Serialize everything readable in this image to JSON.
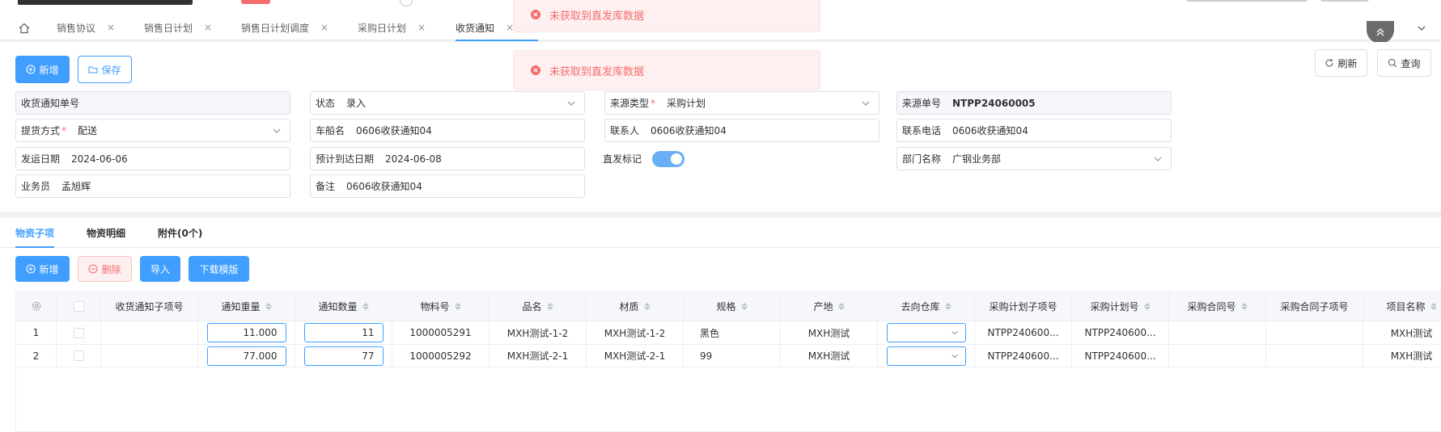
{
  "tabs": [
    {
      "label": "销售协议",
      "active": false
    },
    {
      "label": "销售日计划",
      "active": false
    },
    {
      "label": "销售日计划调度",
      "active": false
    },
    {
      "label": "采购日计划",
      "active": false
    },
    {
      "label": "收货通知",
      "active": true
    }
  ],
  "toasts": [
    {
      "text": "未获取到直发库数据"
    },
    {
      "text": "未获取到直发库数据"
    }
  ],
  "toolbar": {
    "add_label": "新增",
    "save_label": "保存",
    "refresh_label": "刷新",
    "query_label": "查询"
  },
  "form": {
    "receipt_no": {
      "label": "收货通知单号",
      "value": ""
    },
    "status": {
      "label": "状态",
      "value": "录入"
    },
    "source_type": {
      "label": "来源类型",
      "value": "采购计划"
    },
    "source_no": {
      "label": "来源单号",
      "value": "NTPP24060005"
    },
    "delivery_method": {
      "label": "提货方式",
      "value": "配送"
    },
    "vehicle_name": {
      "label": "车船名",
      "value": "0606收获通知04"
    },
    "contact": {
      "label": "联系人",
      "value": "0606收获通知04"
    },
    "phone": {
      "label": "联系电话",
      "value": "0606收获通知04"
    },
    "ship_date": {
      "label": "发运日期",
      "value": "2024-06-06"
    },
    "eta_date": {
      "label": "预计到达日期",
      "value": "2024-06-08"
    },
    "direct_flag": {
      "label": "直发标记",
      "on": true
    },
    "department": {
      "label": "部门名称",
      "value": "广钢业务部"
    },
    "salesman": {
      "label": "业务员",
      "value": "孟旭辉"
    },
    "remark": {
      "label": "备注",
      "value": "0606收获通知04"
    }
  },
  "subtabs": [
    {
      "label": "物资子项",
      "active": true
    },
    {
      "label": "物资明细",
      "active": false
    },
    {
      "label": "附件(0个)",
      "active": false
    }
  ],
  "items_toolbar": {
    "add_label": "新增",
    "delete_label": "删除",
    "import_label": "导入",
    "download_label": "下载模版"
  },
  "table": {
    "columns": [
      "收货通知子项号",
      "通知重量",
      "通知数量",
      "物料号",
      "品名",
      "材质",
      "规格",
      "产地",
      "去向仓库",
      "采购计划子项号",
      "采购计划号",
      "采购合同号",
      "采购合同子项号",
      "项目名称"
    ],
    "rows": [
      {
        "index": "1",
        "sub_no": "",
        "weight": "11.000",
        "qty": "11",
        "material_no": "1000005291",
        "name": "MXH测试-1-2",
        "texture": "MXH测试-1-2",
        "spec": "黑色",
        "origin": "MXH测试",
        "warehouse": "",
        "plan_sub_no": "NTPP240600...",
        "plan_no": "NTPP240600...",
        "contract_no": "",
        "contract_sub_no": "",
        "project": "MXH测试"
      },
      {
        "index": "2",
        "sub_no": "",
        "weight": "77.000",
        "qty": "77",
        "material_no": "1000005292",
        "name": "MXH测试-2-1",
        "texture": "MXH测试-2-1",
        "spec": "99",
        "origin": "MXH测试",
        "warehouse": "",
        "plan_sub_no": "NTPP240600...",
        "plan_no": "NTPP240600...",
        "contract_no": "",
        "contract_sub_no": "",
        "project": "MXH测试"
      }
    ]
  }
}
